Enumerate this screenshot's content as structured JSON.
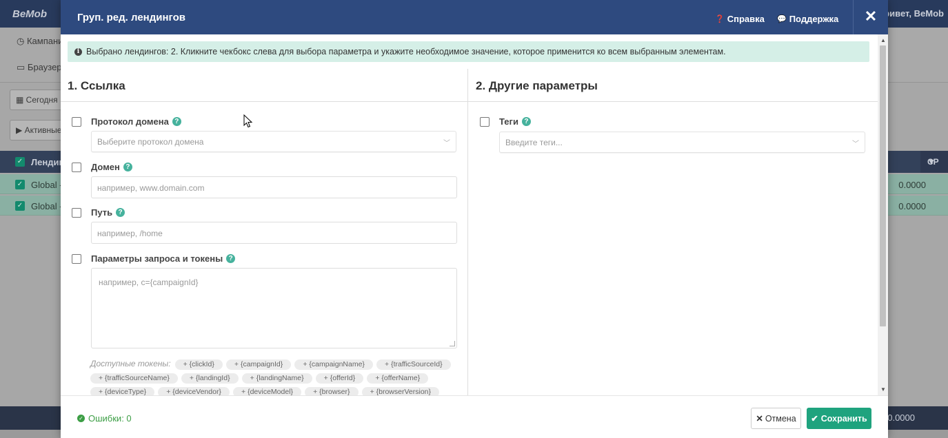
{
  "background": {
    "logo": "BeMob",
    "greeting": "Привет, BeMob",
    "nav": [
      "Кампании",
      "Браузеры"
    ],
    "filters": [
      "Сегодня",
      "Активные"
    ],
    "table_header": "Лендинги",
    "table_header_right": "CP",
    "rows": [
      {
        "name": "Global -",
        "value": "0.0000"
      },
      {
        "name": "Global -",
        "value": "0.0000"
      }
    ],
    "footer_value": "0.0000"
  },
  "modal": {
    "title": "Груп. ред. лендингов",
    "help_link": "Справка",
    "support_link": "Поддержка",
    "close_symbol": "✕",
    "info_message": "Выбрано лендингов: 2. Кликните чекбокс слева для выбора параметра и укажите необходимое значение, которое применится ко всем выбранным элементам.",
    "section_link": {
      "title": "1. Ссылка",
      "fields": {
        "domain_protocol": {
          "label": "Протокол домена",
          "placeholder": "Выберите протокол домена"
        },
        "domain": {
          "label": "Домен",
          "placeholder": "например, www.domain.com"
        },
        "path": {
          "label": "Путь",
          "placeholder": "например, /home"
        },
        "query": {
          "label": "Параметры запроса и токены",
          "placeholder": "например, c={campaignId}"
        }
      },
      "tokens_label": "Доступные токены:",
      "tokens": [
        "+ {clickId}",
        "+ {campaignId}",
        "+ {campaignName}",
        "+ {trafficSourceId}",
        "+ {trafficSourceName}",
        "+ {landingId}",
        "+ {landingName}",
        "+ {offerId}",
        "+ {offerName}",
        "+ {deviceType}",
        "+ {deviceVendor}",
        "+ {deviceModel}",
        "+ {browser}",
        "+ {browserVersion}"
      ]
    },
    "section_other": {
      "title": "2. Другие параметры",
      "tags": {
        "label": "Теги",
        "placeholder": "Введите теги..."
      }
    },
    "footer": {
      "errors": "Ошибки: 0",
      "cancel": "Отмена",
      "save": "Сохранить"
    }
  }
}
